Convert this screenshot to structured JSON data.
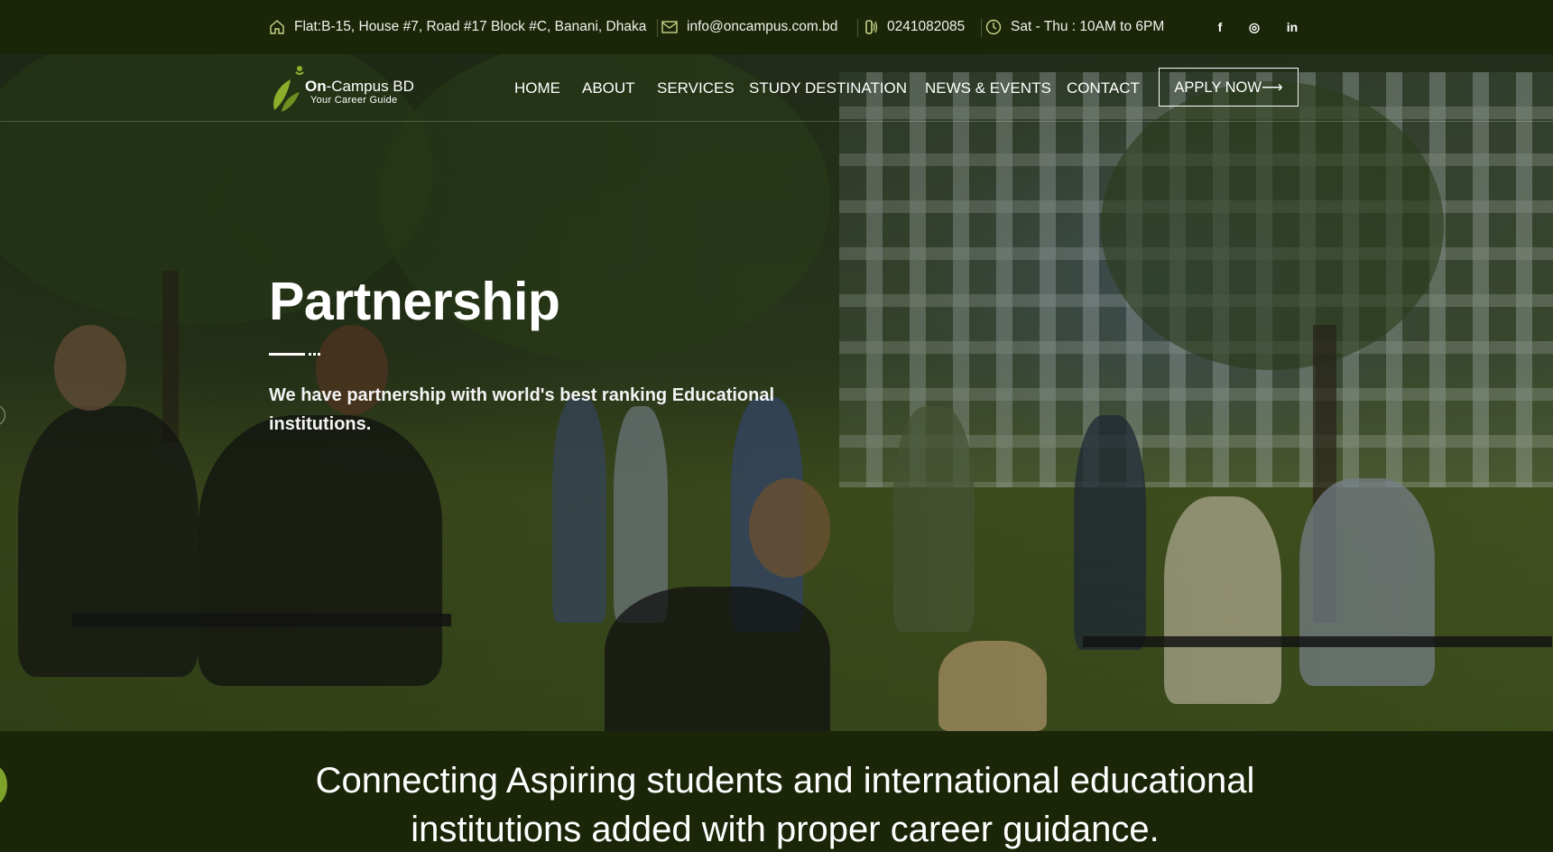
{
  "topbar": {
    "address": "Flat:B-15, House #7, Road #17 Block #C, Banani, Dhaka",
    "email": "info@oncampus.com.bd",
    "phone": "0241082085",
    "hours": "Sat - Thu : 10AM to 6PM",
    "social": {
      "facebook": "f",
      "instagram": "◎",
      "linkedin": "in"
    }
  },
  "logo": {
    "title_bold": "On",
    "title_rest": "-Campus BD",
    "subtitle": "Your Career Guide"
  },
  "nav": {
    "home": "HOME",
    "about": "ABOUT",
    "services": "SERVICES",
    "study_destination": "STUDY DESTINATION",
    "news_events": "NEWS & EVENTS",
    "contact": "CONTACT",
    "apply": "APPLY NOW⟶"
  },
  "hero": {
    "title": "Partnership",
    "description": "We have partnership with world's best ranking Educational institutions."
  },
  "band": {
    "text": "Connecting Aspiring students and international educational institutions added with proper career guidance."
  },
  "colors": {
    "dark_green": "#1b2609",
    "accent_green": "#7da32a"
  }
}
